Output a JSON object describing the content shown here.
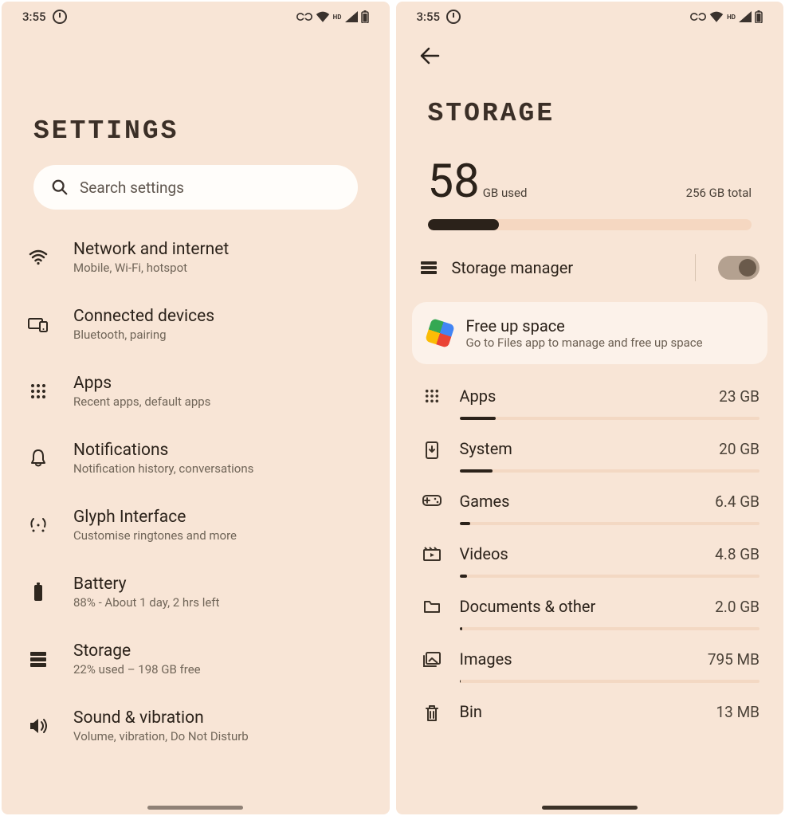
{
  "status": {
    "time": "3:55"
  },
  "settings": {
    "title": "SETTINGS",
    "search_placeholder": "Search settings",
    "items": [
      {
        "title": "Network and internet",
        "sub": "Mobile, Wi-Fi, hotspot"
      },
      {
        "title": "Connected devices",
        "sub": "Bluetooth, pairing"
      },
      {
        "title": "Apps",
        "sub": "Recent apps, default apps"
      },
      {
        "title": "Notifications",
        "sub": "Notification history, conversations"
      },
      {
        "title": "Glyph Interface",
        "sub": "Customise ringtones and more"
      },
      {
        "title": "Battery",
        "sub": "88% - About 1 day, 2 hrs left"
      },
      {
        "title": "Storage",
        "sub": "22% used – 198 GB free"
      },
      {
        "title": "Sound & vibration",
        "sub": "Volume, vibration, Do Not Disturb"
      }
    ]
  },
  "storage": {
    "title": "STORAGE",
    "used_number": "58",
    "used_unit": "GB used",
    "total_label": "256 GB total",
    "used_percent": 22,
    "manager_label": "Storage manager",
    "freeup": {
      "title": "Free up space",
      "sub": "Go to Files app to manage and free up space"
    },
    "categories": [
      {
        "name": "Apps",
        "size": "23 GB",
        "percent": 12
      },
      {
        "name": "System",
        "size": "20 GB",
        "percent": 11
      },
      {
        "name": "Games",
        "size": "6.4 GB",
        "percent": 3.5
      },
      {
        "name": "Videos",
        "size": "4.8 GB",
        "percent": 2.6
      },
      {
        "name": "Documents & other",
        "size": "2.0 GB",
        "percent": 1
      },
      {
        "name": "Images",
        "size": "795 MB",
        "percent": 0.4
      },
      {
        "name": "Bin",
        "size": "13 MB",
        "percent": 0.1
      }
    ]
  }
}
